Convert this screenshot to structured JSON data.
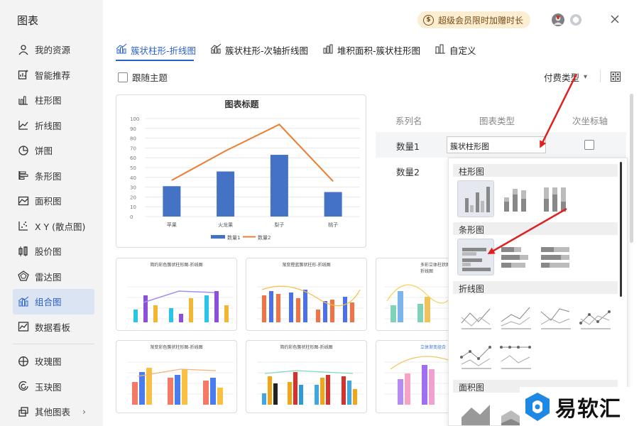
{
  "sidebar": {
    "title": "图表",
    "items": [
      {
        "label": "我的资源",
        "icon": "user-icon"
      },
      {
        "label": "智能推荐",
        "icon": "smart-recommend-icon"
      },
      {
        "label": "柱形图",
        "icon": "column-chart-icon"
      },
      {
        "label": "折线图",
        "icon": "line-chart-icon"
      },
      {
        "label": "饼图",
        "icon": "pie-chart-icon"
      },
      {
        "label": "条形图",
        "icon": "bar-chart-icon"
      },
      {
        "label": "面积图",
        "icon": "area-chart-icon"
      },
      {
        "label": "X Y (散点图)",
        "icon": "scatter-chart-icon"
      },
      {
        "label": "股价图",
        "icon": "stock-chart-icon"
      },
      {
        "label": "雷达图",
        "icon": "radar-chart-icon"
      },
      {
        "label": "组合图",
        "icon": "combo-chart-icon",
        "active": true
      },
      {
        "label": "数据看板",
        "icon": "dashboard-icon"
      }
    ],
    "items2": [
      {
        "label": "玫瑰图",
        "icon": "rose-chart-icon"
      },
      {
        "label": "玉玦图",
        "icon": "jade-ring-chart-icon"
      },
      {
        "label": "其他图表",
        "icon": "other-charts-icon"
      }
    ],
    "more_glyph": "›"
  },
  "topbar": {
    "vip_text": "超级会员限时加赠时长",
    "coin_glyph": "$"
  },
  "tabs": [
    {
      "label": "簇状柱形-折线图",
      "active": true
    },
    {
      "label": "簇状柱形-次轴折线图"
    },
    {
      "label": "堆积面积-簇状柱形图"
    },
    {
      "label": "自定义"
    }
  ],
  "options": {
    "follow_theme": "跟随主题",
    "paid_type": "付费类型",
    "paid_caret": "▾"
  },
  "preview_chart": {
    "chart_data": {
      "type": "bar+line",
      "title": "图表标题",
      "categories": [
        "苹果",
        "火龙果",
        "梨子",
        "桃子"
      ],
      "series": [
        {
          "name": "数量1",
          "type": "bar",
          "values": [
            31,
            46,
            63,
            25
          ]
        },
        {
          "name": "数量2",
          "type": "line",
          "values": [
            37,
            67,
            94,
            36
          ]
        }
      ],
      "ylim": [
        0,
        100
      ],
      "yticks": [
        "0",
        "10",
        "20",
        "30",
        "40",
        "50",
        "60",
        "70",
        "80",
        "90",
        "100"
      ],
      "colors": {
        "bar": "#4472c4",
        "line": "#ed7d31"
      },
      "legend": "bottom",
      "grid": true
    }
  },
  "thumbnails": [
    {
      "title": "简约彩色簇状柱形图-折线图"
    },
    {
      "title": "渐变橙蓝簇状柱形-折线图"
    },
    {
      "title": "多彩立体柱状图-折线图"
    },
    {
      "title": "渐变彩色簇状柱形图-折线图"
    },
    {
      "title": "简约彩色簇状柱形图-折线图"
    },
    {
      "title": "立体渐变组合"
    }
  ],
  "series_config": {
    "headers": [
      "系列名",
      "图表类型",
      "次坐标轴"
    ],
    "rows": [
      {
        "name": "数量1",
        "type": "簇状柱形图"
      },
      {
        "name": "数量2"
      }
    ]
  },
  "dropdown": {
    "sections": [
      "柱形图",
      "条形图",
      "折线图",
      "面积图"
    ]
  },
  "watermark": {
    "text": "易软汇"
  }
}
